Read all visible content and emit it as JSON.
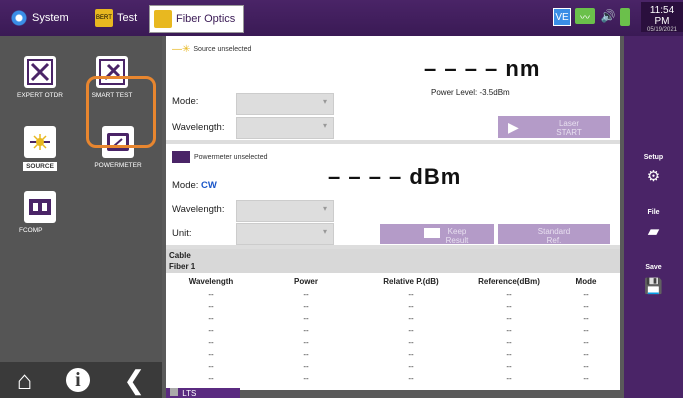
{
  "topbar": {
    "tabs": [
      {
        "label": "System",
        "icon": "gear-icon"
      },
      {
        "label": "Test",
        "icon": "bert-icon",
        "icon_text": "BERT"
      },
      {
        "label": "Fiber Optics",
        "icon": "fiber-optics-icon"
      }
    ],
    "tray": {
      "ve": "VE",
      "time": "11:54 PM",
      "date": "05/19/2021"
    }
  },
  "left": {
    "apps": [
      {
        "label": "EXPERT OTDR"
      },
      {
        "label": "SMART TEST"
      },
      {
        "label": "SOURCE"
      },
      {
        "label": "POWERMETER"
      },
      {
        "label": "FCOMP"
      }
    ]
  },
  "source": {
    "header": "Source unselected",
    "value": "– – – – nm",
    "power_level": "Power Level: -3.5dBm",
    "mode_label": "Mode:",
    "wavelength_label": "Wavelength:",
    "laser_btn_1": "Laser",
    "laser_btn_2": "START"
  },
  "powermeter": {
    "header": "Powermeter unselected",
    "value": "– – – – dBm",
    "mode_label": "Mode:",
    "mode_value": "CW",
    "wavelength_label": "Wavelength:",
    "unit_label": "Unit:",
    "keep_btn_1": "Keep",
    "keep_btn_2": "Result",
    "std_btn_1": "Standard",
    "std_btn_2": "Ref."
  },
  "table": {
    "cable": "Cable",
    "fiber": "Fiber 1",
    "columns": [
      "Wavelength",
      "Power",
      "Relative P.(dB)",
      "Reference(dBm)",
      "Mode"
    ],
    "rows": [
      [
        "--",
        "--",
        "--",
        "--",
        "--"
      ],
      [
        "--",
        "--",
        "--",
        "--",
        "--"
      ],
      [
        "--",
        "--",
        "--",
        "--",
        "--"
      ],
      [
        "--",
        "--",
        "--",
        "--",
        "--"
      ],
      [
        "--",
        "--",
        "--",
        "--",
        "--"
      ],
      [
        "--",
        "--",
        "--",
        "--",
        "--"
      ],
      [
        "--",
        "--",
        "--",
        "--",
        "--"
      ],
      [
        "--",
        "--",
        "--",
        "--",
        "--"
      ]
    ]
  },
  "right": {
    "setup": "Setup",
    "file": "File",
    "save": "Save"
  },
  "bottom": {
    "lts": "LTS"
  }
}
